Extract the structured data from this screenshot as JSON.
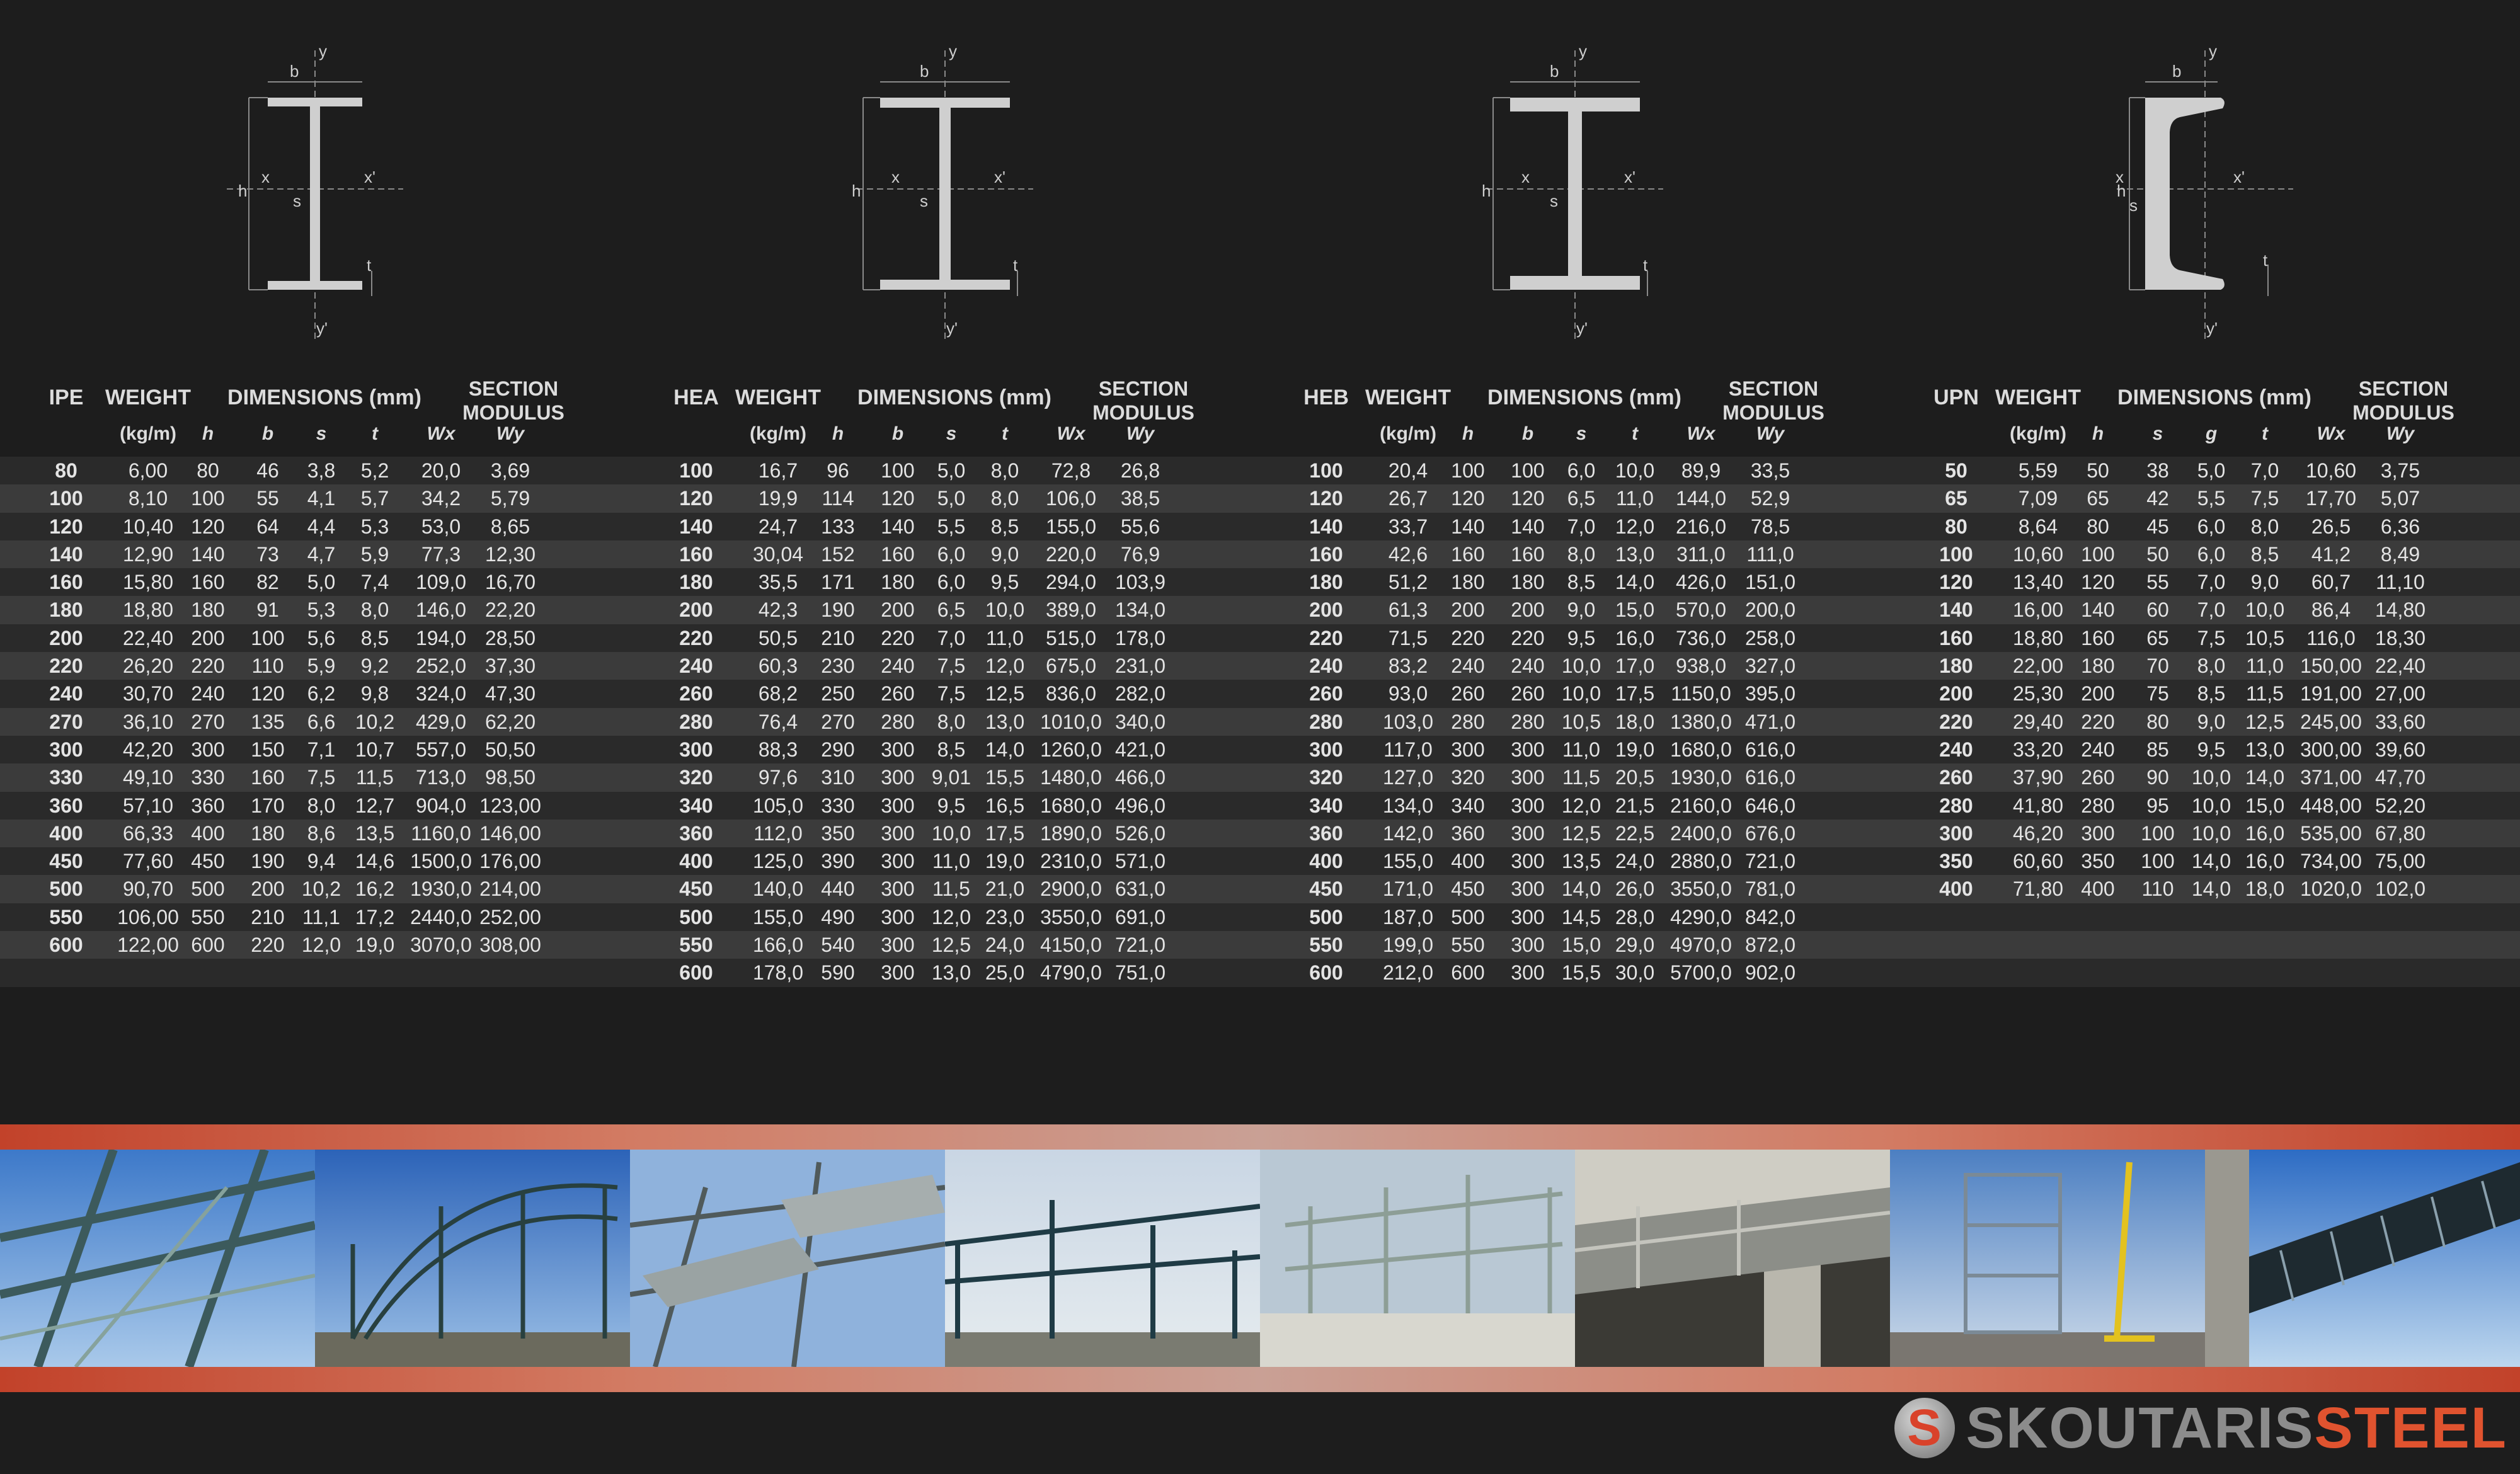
{
  "diagram_labels": {
    "b": "b",
    "y": "y",
    "y_prime": "y'",
    "x": "x",
    "x_prime": "x'",
    "h": "h",
    "s": "s",
    "t": "t"
  },
  "tables": [
    {
      "id": "ipe",
      "headers": {
        "profile": "IPE",
        "weight": "WEIGHT",
        "dimensions": "DIMENSIONS (mm)",
        "section": "SECTION",
        "modulus": "MODULUS",
        "unit": "(kg/m)",
        "c1": "h",
        "c2": "b",
        "c3": "s",
        "c4": "t",
        "c5": "Wx",
        "c6": "Wy"
      },
      "rows": [
        [
          "80",
          "6,00",
          "80",
          "46",
          "3,8",
          "5,2",
          "20,0",
          "3,69"
        ],
        [
          "100",
          "8,10",
          "100",
          "55",
          "4,1",
          "5,7",
          "34,2",
          "5,79"
        ],
        [
          "120",
          "10,40",
          "120",
          "64",
          "4,4",
          "5,3",
          "53,0",
          "8,65"
        ],
        [
          "140",
          "12,90",
          "140",
          "73",
          "4,7",
          "5,9",
          "77,3",
          "12,30"
        ],
        [
          "160",
          "15,80",
          "160",
          "82",
          "5,0",
          "7,4",
          "109,0",
          "16,70"
        ],
        [
          "180",
          "18,80",
          "180",
          "91",
          "5,3",
          "8,0",
          "146,0",
          "22,20"
        ],
        [
          "200",
          "22,40",
          "200",
          "100",
          "5,6",
          "8,5",
          "194,0",
          "28,50"
        ],
        [
          "220",
          "26,20",
          "220",
          "110",
          "5,9",
          "9,2",
          "252,0",
          "37,30"
        ],
        [
          "240",
          "30,70",
          "240",
          "120",
          "6,2",
          "9,8",
          "324,0",
          "47,30"
        ],
        [
          "270",
          "36,10",
          "270",
          "135",
          "6,6",
          "10,2",
          "429,0",
          "62,20"
        ],
        [
          "300",
          "42,20",
          "300",
          "150",
          "7,1",
          "10,7",
          "557,0",
          "50,50"
        ],
        [
          "330",
          "49,10",
          "330",
          "160",
          "7,5",
          "11,5",
          "713,0",
          "98,50"
        ],
        [
          "360",
          "57,10",
          "360",
          "170",
          "8,0",
          "12,7",
          "904,0",
          "123,00"
        ],
        [
          "400",
          "66,33",
          "400",
          "180",
          "8,6",
          "13,5",
          "1160,0",
          "146,00"
        ],
        [
          "450",
          "77,60",
          "450",
          "190",
          "9,4",
          "14,6",
          "1500,0",
          "176,00"
        ],
        [
          "500",
          "90,70",
          "500",
          "200",
          "10,2",
          "16,2",
          "1930,0",
          "214,00"
        ],
        [
          "550",
          "106,00",
          "550",
          "210",
          "11,1",
          "17,2",
          "2440,0",
          "252,00"
        ],
        [
          "600",
          "122,00",
          "600",
          "220",
          "12,0",
          "19,0",
          "3070,0",
          "308,00"
        ]
      ]
    },
    {
      "id": "hea",
      "headers": {
        "profile": "HEA",
        "weight": "WEIGHT",
        "dimensions": "DIMENSIONS (mm)",
        "section": "SECTION",
        "modulus": "MODULUS",
        "unit": "(kg/m)",
        "c1": "h",
        "c2": "b",
        "c3": "s",
        "c4": "t",
        "c5": "Wx",
        "c6": "Wy"
      },
      "rows": [
        [
          "100",
          "16,7",
          "96",
          "100",
          "5,0",
          "8,0",
          "72,8",
          "26,8"
        ],
        [
          "120",
          "19,9",
          "114",
          "120",
          "5,0",
          "8,0",
          "106,0",
          "38,5"
        ],
        [
          "140",
          "24,7",
          "133",
          "140",
          "5,5",
          "8,5",
          "155,0",
          "55,6"
        ],
        [
          "160",
          "30,04",
          "152",
          "160",
          "6,0",
          "9,0",
          "220,0",
          "76,9"
        ],
        [
          "180",
          "35,5",
          "171",
          "180",
          "6,0",
          "9,5",
          "294,0",
          "103,9"
        ],
        [
          "200",
          "42,3",
          "190",
          "200",
          "6,5",
          "10,0",
          "389,0",
          "134,0"
        ],
        [
          "220",
          "50,5",
          "210",
          "220",
          "7,0",
          "11,0",
          "515,0",
          "178,0"
        ],
        [
          "240",
          "60,3",
          "230",
          "240",
          "7,5",
          "12,0",
          "675,0",
          "231,0"
        ],
        [
          "260",
          "68,2",
          "250",
          "260",
          "7,5",
          "12,5",
          "836,0",
          "282,0"
        ],
        [
          "280",
          "76,4",
          "270",
          "280",
          "8,0",
          "13,0",
          "1010,0",
          "340,0"
        ],
        [
          "300",
          "88,3",
          "290",
          "300",
          "8,5",
          "14,0",
          "1260,0",
          "421,0"
        ],
        [
          "320",
          "97,6",
          "310",
          "300",
          "9,01",
          "15,5",
          "1480,0",
          "466,0"
        ],
        [
          "340",
          "105,0",
          "330",
          "300",
          "9,5",
          "16,5",
          "1680,0",
          "496,0"
        ],
        [
          "360",
          "112,0",
          "350",
          "300",
          "10,0",
          "17,5",
          "1890,0",
          "526,0"
        ],
        [
          "400",
          "125,0",
          "390",
          "300",
          "11,0",
          "19,0",
          "2310,0",
          "571,0"
        ],
        [
          "450",
          "140,0",
          "440",
          "300",
          "11,5",
          "21,0",
          "2900,0",
          "631,0"
        ],
        [
          "500",
          "155,0",
          "490",
          "300",
          "12,0",
          "23,0",
          "3550,0",
          "691,0"
        ],
        [
          "550",
          "166,0",
          "540",
          "300",
          "12,5",
          "24,0",
          "4150,0",
          "721,0"
        ],
        [
          "600",
          "178,0",
          "590",
          "300",
          "13,0",
          "25,0",
          "4790,0",
          "751,0"
        ]
      ]
    },
    {
      "id": "heb",
      "headers": {
        "profile": "HEB",
        "weight": "WEIGHT",
        "dimensions": "DIMENSIONS (mm)",
        "section": "SECTION",
        "modulus": "MODULUS",
        "unit": "(kg/m)",
        "c1": "h",
        "c2": "b",
        "c3": "s",
        "c4": "t",
        "c5": "Wx",
        "c6": "Wy"
      },
      "rows": [
        [
          "100",
          "20,4",
          "100",
          "100",
          "6,0",
          "10,0",
          "89,9",
          "33,5"
        ],
        [
          "120",
          "26,7",
          "120",
          "120",
          "6,5",
          "11,0",
          "144,0",
          "52,9"
        ],
        [
          "140",
          "33,7",
          "140",
          "140",
          "7,0",
          "12,0",
          "216,0",
          "78,5"
        ],
        [
          "160",
          "42,6",
          "160",
          "160",
          "8,0",
          "13,0",
          "311,0",
          "111,0"
        ],
        [
          "180",
          "51,2",
          "180",
          "180",
          "8,5",
          "14,0",
          "426,0",
          "151,0"
        ],
        [
          "200",
          "61,3",
          "200",
          "200",
          "9,0",
          "15,0",
          "570,0",
          "200,0"
        ],
        [
          "220",
          "71,5",
          "220",
          "220",
          "9,5",
          "16,0",
          "736,0",
          "258,0"
        ],
        [
          "240",
          "83,2",
          "240",
          "240",
          "10,0",
          "17,0",
          "938,0",
          "327,0"
        ],
        [
          "260",
          "93,0",
          "260",
          "260",
          "10,0",
          "17,5",
          "1150,0",
          "395,0"
        ],
        [
          "280",
          "103,0",
          "280",
          "280",
          "10,5",
          "18,0",
          "1380,0",
          "471,0"
        ],
        [
          "300",
          "117,0",
          "300",
          "300",
          "11,0",
          "19,0",
          "1680,0",
          "616,0"
        ],
        [
          "320",
          "127,0",
          "320",
          "300",
          "11,5",
          "20,5",
          "1930,0",
          "616,0"
        ],
        [
          "340",
          "134,0",
          "340",
          "300",
          "12,0",
          "21,5",
          "2160,0",
          "646,0"
        ],
        [
          "360",
          "142,0",
          "360",
          "300",
          "12,5",
          "22,5",
          "2400,0",
          "676,0"
        ],
        [
          "400",
          "155,0",
          "400",
          "300",
          "13,5",
          "24,0",
          "2880,0",
          "721,0"
        ],
        [
          "450",
          "171,0",
          "450",
          "300",
          "14,0",
          "26,0",
          "3550,0",
          "781,0"
        ],
        [
          "500",
          "187,0",
          "500",
          "300",
          "14,5",
          "28,0",
          "4290,0",
          "842,0"
        ],
        [
          "550",
          "199,0",
          "550",
          "300",
          "15,0",
          "29,0",
          "4970,0",
          "872,0"
        ],
        [
          "600",
          "212,0",
          "600",
          "300",
          "15,5",
          "30,0",
          "5700,0",
          "902,0"
        ]
      ]
    },
    {
      "id": "upn",
      "headers": {
        "profile": "UPN",
        "weight": "WEIGHT",
        "dimensions": "DIMENSIONS (mm)",
        "section": "SECTION",
        "modulus": "MODULUS",
        "unit": "(kg/m)",
        "c1": "h",
        "c2": "s",
        "c3": "g",
        "c4": "t",
        "c5": "Wx",
        "c6": "Wy"
      },
      "rows": [
        [
          "50",
          "5,59",
          "50",
          "38",
          "5,0",
          "7,0",
          "10,60",
          "3,75"
        ],
        [
          "65",
          "7,09",
          "65",
          "42",
          "5,5",
          "7,5",
          "17,70",
          "5,07"
        ],
        [
          "80",
          "8,64",
          "80",
          "45",
          "6,0",
          "8,0",
          "26,5",
          "6,36"
        ],
        [
          "100",
          "10,60",
          "100",
          "50",
          "6,0",
          "8,5",
          "41,2",
          "8,49"
        ],
        [
          "120",
          "13,40",
          "120",
          "55",
          "7,0",
          "9,0",
          "60,7",
          "11,10"
        ],
        [
          "140",
          "16,00",
          "140",
          "60",
          "7,0",
          "10,0",
          "86,4",
          "14,80"
        ],
        [
          "160",
          "18,80",
          "160",
          "65",
          "7,5",
          "10,5",
          "116,0",
          "18,30"
        ],
        [
          "180",
          "22,00",
          "180",
          "70",
          "8,0",
          "11,0",
          "150,00",
          "22,40"
        ],
        [
          "200",
          "25,30",
          "200",
          "75",
          "8,5",
          "11,5",
          "191,00",
          "27,00"
        ],
        [
          "220",
          "29,40",
          "220",
          "80",
          "9,0",
          "12,5",
          "245,00",
          "33,60"
        ],
        [
          "240",
          "33,20",
          "240",
          "85",
          "9,5",
          "13,0",
          "300,00",
          "39,60"
        ],
        [
          "260",
          "37,90",
          "260",
          "90",
          "10,0",
          "14,0",
          "371,00",
          "47,70"
        ],
        [
          "280",
          "41,80",
          "280",
          "95",
          "10,0",
          "15,0",
          "448,00",
          "52,20"
        ],
        [
          "300",
          "46,20",
          "300",
          "100",
          "10,0",
          "16,0",
          "535,00",
          "67,80"
        ],
        [
          "350",
          "60,60",
          "350",
          "100",
          "14,0",
          "16,0",
          "734,00",
          "75,00"
        ],
        [
          "400",
          "71,80",
          "400",
          "110",
          "14,0",
          "18,0",
          "1020,0",
          "102,0"
        ]
      ]
    }
  ],
  "logo": {
    "part1": "SKOUTARIS",
    "part2": "STEEL",
    "mark": "S"
  },
  "colors": {
    "brand": "#e0532f",
    "band": "#c2422a",
    "background": "#1d1d1d"
  }
}
